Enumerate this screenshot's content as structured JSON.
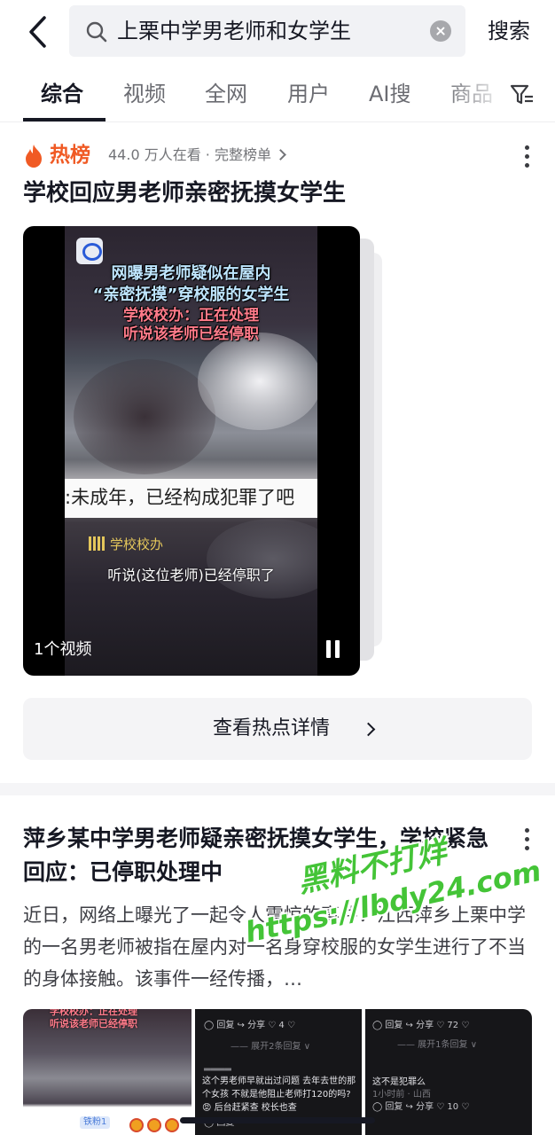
{
  "search": {
    "query": "上栗中学男老师和女学生",
    "submit_label": "搜索"
  },
  "tabs": [
    "综合",
    "视频",
    "全网",
    "用户",
    "AI搜",
    "商品"
  ],
  "hot": {
    "badge": "热榜",
    "meta": "44.0 万人在看 · 完整榜单",
    "title": "学校回应男老师亲密抚摸女学生",
    "video": {
      "headline_1": "网曝男老师疑似在屋内",
      "headline_2": "“亲密抚摸”穿校服的女学生",
      "headline_3": "学校校办：正在处理",
      "headline_4": "听说该老师已经停职",
      "subtitle_bar": ":未成年，已经构成犯罪了吧",
      "speaker": "学校校办",
      "caption": "听说(这位老师)已经停职了",
      "count": "1个视频"
    },
    "detail_button": "查看热点详情"
  },
  "article": {
    "title": "萍乡某中学男老师疑亲密抚摸女学生，学校紧急回应：已停职处理中",
    "body": "近日，网络上曝光了一起令人震惊的事件：江西萍乡上栗中学的一名男老师被指在屋内对一名身穿校服的女学生进行了不当的身体接触。该事件一经传播，…",
    "watermark_1": "黑料不打烊",
    "watermark_2": "https://lbdy24.com",
    "thumb1": {
      "line1": "学校校办：正在处理",
      "line2": "听说该老师已经停职",
      "tag": "铁粉1"
    },
    "thumb2": {
      "actions": "◯ 回复  ↪ 分享  ♡ 4  ♡",
      "expand": "—— 展开2条回复 ∨",
      "comment": "这个男老师早就出过问题 去年去世的那个女孩 不就是他阻止老师打120的吗? 😡 后台赶紧查 校长也查",
      "footer": "◯ 回复"
    },
    "thumb3": {
      "actions": "◯ 回复  ↪ 分享  ♡ 72  ♡",
      "expand": "—— 展开1条回复 ∨",
      "comment": "这不是犯罪么",
      "time": "1小时前 · 山西",
      "footer": "◯ 回复  ↪ 分享  ♡ 10  ♡"
    }
  },
  "colors": {
    "hot": "#f05a24",
    "text": "#161823",
    "watermark": "#44c437"
  }
}
